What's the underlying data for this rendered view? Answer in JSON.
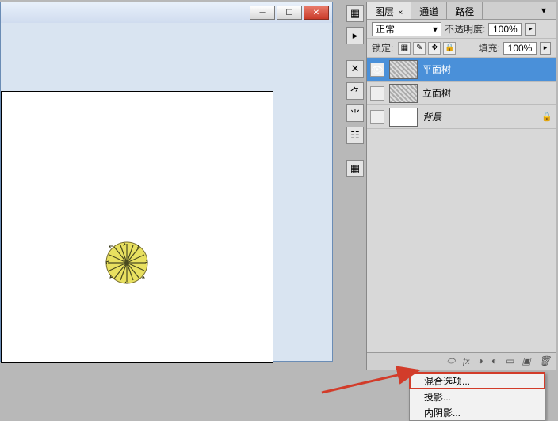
{
  "window_controls": {
    "min": "─",
    "max": "☐",
    "close": "✕"
  },
  "panel": {
    "tabs": [
      {
        "label": "图层",
        "active": true
      },
      {
        "label": "通道",
        "active": false
      },
      {
        "label": "路径",
        "active": false
      }
    ],
    "blend_mode": "正常",
    "opacity_label": "不透明度:",
    "opacity_value": "100%",
    "lock_label": "锁定:",
    "fill_label": "填充:",
    "fill_value": "100%",
    "layers": [
      {
        "name": "平面树",
        "visible": true,
        "selected": true,
        "patterned": true,
        "locked": false
      },
      {
        "name": "立面树",
        "visible": false,
        "selected": false,
        "patterned": true,
        "locked": false
      },
      {
        "name": "背景",
        "visible": false,
        "selected": false,
        "patterned": false,
        "locked": true
      }
    ],
    "footer_icons": [
      "⬭",
      "fx",
      "◑",
      "◐",
      "▭",
      "▣",
      "🗑"
    ]
  },
  "context_menu": {
    "items": [
      {
        "label": "混合选项...",
        "highlight": true
      },
      {
        "label": "投影...",
        "highlight": false
      },
      {
        "label": "内阴影...",
        "highlight": false
      }
    ]
  },
  "toolbar_icons": [
    "▦",
    "▸",
    "—",
    "✕",
    "⺈",
    "⺌",
    "☷",
    "—",
    "▦"
  ]
}
